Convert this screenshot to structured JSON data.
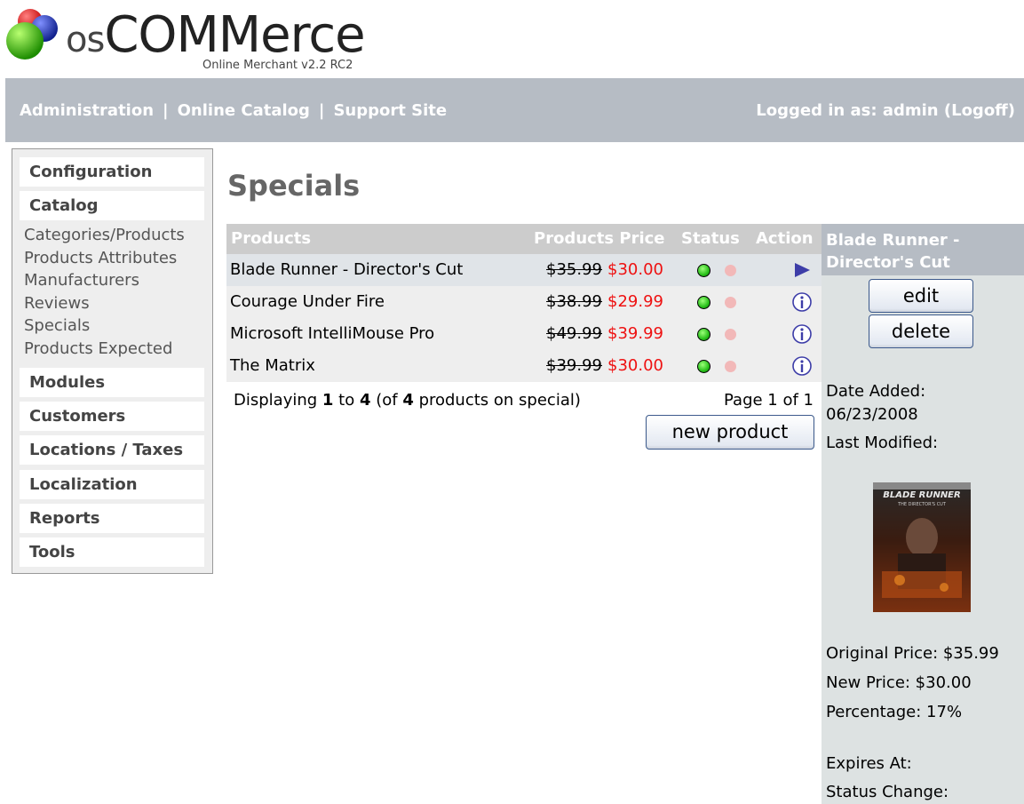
{
  "header": {
    "logo_os": "os",
    "logo_commerce": "COMMerce",
    "version": "Online Merchant v2.2 RC2"
  },
  "topnav": {
    "links": [
      "Administration",
      "Online Catalog",
      "Support Site"
    ],
    "separator": "|",
    "login_prefix": "Logged in as: admin (",
    "logoff": "Logoff",
    "login_suffix": ")"
  },
  "sidebar": {
    "configuration": "Configuration",
    "catalog": "Catalog",
    "catalog_links": [
      "Categories/Products",
      "Products Attributes",
      "Manufacturers",
      "Reviews",
      "Specials",
      "Products Expected"
    ],
    "modules": "Modules",
    "customers": "Customers",
    "locations": "Locations / Taxes",
    "localization": "Localization",
    "reports": "Reports",
    "tools": "Tools"
  },
  "main": {
    "title": "Specials",
    "columns": {
      "products": "Products",
      "price": "Products Price",
      "status": "Status",
      "action": "Action"
    },
    "rows": [
      {
        "name": "Blade Runner - Director's Cut",
        "old_price": "$35.99",
        "new_price": "$30.00",
        "action_icon": "arrow-right-icon"
      },
      {
        "name": "Courage Under Fire",
        "old_price": "$38.99",
        "new_price": "$29.99",
        "action_icon": "info-icon"
      },
      {
        "name": "Microsoft IntelliMouse Pro",
        "old_price": "$49.99",
        "new_price": "$39.99",
        "action_icon": "info-icon"
      },
      {
        "name": "The Matrix",
        "old_price": "$39.99",
        "new_price": "$30.00",
        "action_icon": "info-icon"
      }
    ],
    "displaying": {
      "prefix": "Displaying ",
      "from": "1",
      "to_word": " to ",
      "to": "4",
      "of_prefix": " (of ",
      "total": "4",
      "suffix": " products on special)"
    },
    "page": "Page 1 of 1",
    "new_product": "new product"
  },
  "info": {
    "title": "Blade Runner - Director's Cut",
    "edit": "edit",
    "delete": "delete",
    "date_added_label": "Date Added:",
    "date_added": "06/23/2008",
    "last_modified": "Last Modified:",
    "dvd_title": "BLADE RUNNER",
    "dvd_subtitle": "THE DIRECTOR'S CUT",
    "original_price": "Original Price: $35.99",
    "new_price": "New Price: $30.00",
    "percentage": "Percentage: 17%",
    "expires": "Expires At:",
    "status_change": "Status Change:"
  },
  "colors": {
    "nav_bg": "#b6bcc4",
    "sale_price": "#ee1111",
    "status_active": "#28c01a"
  }
}
